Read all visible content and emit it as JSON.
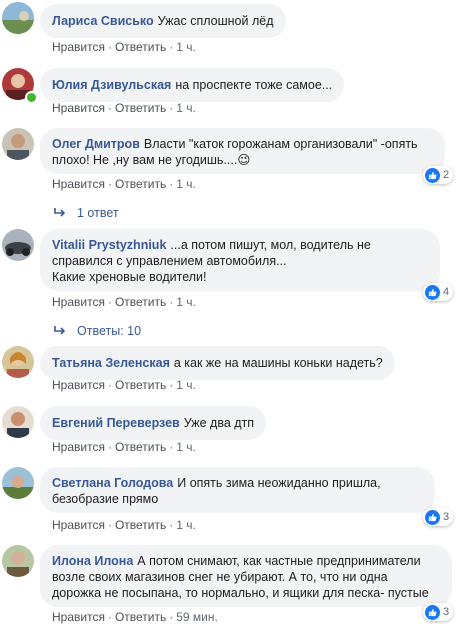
{
  "actions": {
    "like": "Нравится",
    "reply": "Ответить",
    "dot": "·"
  },
  "colors": {
    "author": "#385898",
    "bubble": "#f2f3f5",
    "like_blue": "#1877f2",
    "online": "#42b72a"
  },
  "comments": [
    {
      "author": "Лариса Свисько",
      "text": "Ужас сплошной лёд",
      "time": "1 ч."
    },
    {
      "author": "Юлия Дзивульская",
      "text": "на проспекте тоже самое...",
      "time": "1 ч."
    },
    {
      "author": "Олег Дмитров",
      "text": "Власти \"каток горожанам организовали\" -опять плохо! Не ,ну вам не угодишь....😉",
      "time": "1 ч.",
      "likes": "2",
      "replies": "1 ответ"
    },
    {
      "author": "Vitalii Prystyzhniuk",
      "text": "...а потом пишут, мол, водитель не справился с управлением автомобиля...",
      "text2": "Какие хреновые водители!",
      "time": "1 ч.",
      "likes": "4",
      "replies": "Ответы: 10"
    },
    {
      "author": "Татьяна Зеленская",
      "text": "а как же на машины коньки надеть?",
      "time": "1 ч."
    },
    {
      "author": "Евгений Переверзев",
      "text": "Уже два дтп",
      "time": "1 ч."
    },
    {
      "author": "Светлана Голодова",
      "text": "И опять зима неожиданно пришла, безобразие прямо",
      "time": "1 ч.",
      "likes": "3"
    },
    {
      "author": "Илона Илона",
      "text": "А потом снимают, как частные предприниматели возле своих магазинов снег не убирают. А то, что ни одна дорожка не посыпана, то нормально, и ящики для песка- пустые",
      "time": "59 мин.",
      "likes": "3"
    }
  ]
}
